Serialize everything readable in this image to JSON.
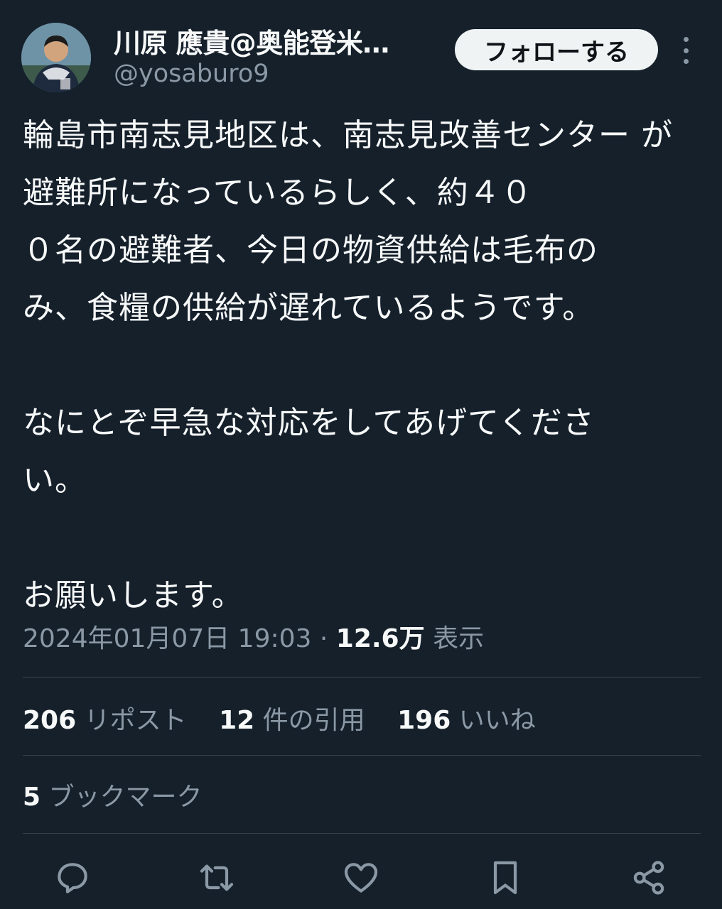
{
  "author": {
    "display_name": "川原 應貴@奥能登米…",
    "handle": "@yosaburo9",
    "follow_label": "フォローする"
  },
  "tweet": {
    "text": "輪島市南志見地区は、南志見改善センター が避難所になっているらしく、約４０\n０名の避難者、今日の物資供給は毛布の\nみ、食糧の供給が遅れているようです。\n\nなにとぞ早急な対応をしてあげてくださ\nい。\n\nお願いします。",
    "datetime": "2024年01月07日 19:03",
    "views_count": "12.6万",
    "views_label": "表示"
  },
  "stats": {
    "reposts_count": "206",
    "reposts_label": "リポスト",
    "quotes_count": "12",
    "quotes_label": "件の引用",
    "likes_count": "196",
    "likes_label": "いいね",
    "bookmarks_count": "5",
    "bookmarks_label": "ブックマーク"
  },
  "actions": [
    "reply-icon",
    "repost-icon",
    "like-icon",
    "bookmark-icon",
    "share-icon"
  ],
  "colors": {
    "background": "#15202b",
    "secondary_text": "#8b98a5",
    "divider": "#38444d"
  }
}
